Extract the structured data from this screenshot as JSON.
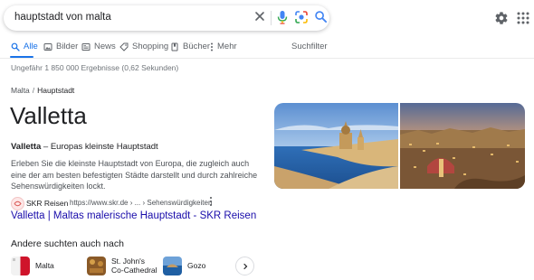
{
  "search": {
    "query": "hauptstadt von malta",
    "clear_icon": "close-icon",
    "mic_icon": "microphone-icon",
    "lens_icon": "lens-camera-icon",
    "search_icon": "search-icon"
  },
  "header": {
    "settings_icon": "gear-icon",
    "apps_icon": "apps-grid-icon"
  },
  "tabs": [
    {
      "label": "Alle",
      "icon": "search-icon",
      "active": true
    },
    {
      "label": "Bilder",
      "icon": "image-icon"
    },
    {
      "label": "News",
      "icon": "news-icon"
    },
    {
      "label": "Shopping",
      "icon": "tag-icon"
    },
    {
      "label": "Bücher",
      "icon": "book-icon"
    },
    {
      "label": "Mehr",
      "icon": "more-vert-icon"
    }
  ],
  "tools_label": "Suchfilter",
  "stats": "Ungefähr 1 850 000 Ergebnisse (0,62 Sekunden)",
  "breadcrumb": {
    "parent": "Malta",
    "separator": "/",
    "current": "Hauptstadt"
  },
  "answer": {
    "title": "Valletta",
    "subtitle_bold": "Valletta",
    "subtitle_rest": " – Europas kleinste Hauptstadt",
    "description": "Erleben Sie die kleinste Hauptstadt von Europa, die zugleich auch eine der am besten befestigten Städte darstellt und durch zahlreiche Sehenswürdigkeiten lockt."
  },
  "source": {
    "name": "SKR Reisen",
    "url": "https://www.skr.de › ... › Sehenswürdigkeiten",
    "link_text": "Valletta | Maltas malerische Hauptstadt - SKR Reisen"
  },
  "also_searched": {
    "heading": "Andere suchten auch nach",
    "items": [
      {
        "label": "Malta"
      },
      {
        "label_line1": "St. John's",
        "label_line2": "Co-Cathedral"
      },
      {
        "label": "Gozo"
      }
    ]
  },
  "colors": {
    "accent": "#1a73e8",
    "link": "#1a0dab",
    "text": "#202124",
    "muted": "#70757a"
  }
}
